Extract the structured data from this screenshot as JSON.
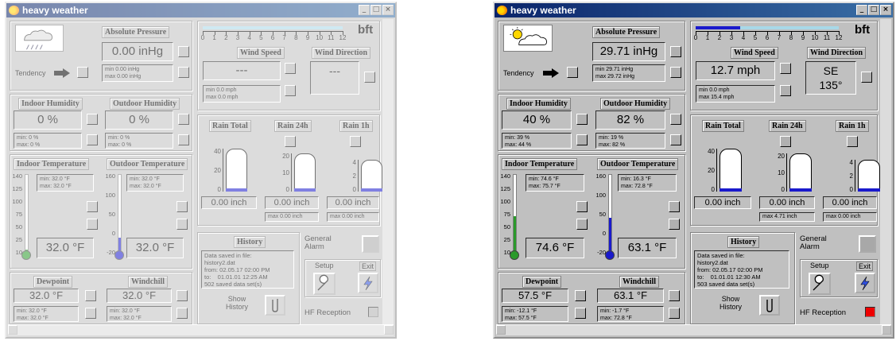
{
  "windows": [
    {
      "title": "heavy weather",
      "state": "faded",
      "pressure": {
        "label": "Absolute Pressure",
        "value": "0.00 inHg",
        "min": "min 0.00 inHg",
        "max": "max 0.00 inHg"
      },
      "tendency": "Tendency",
      "bft": "bft",
      "wind_speed": {
        "label": "Wind Speed",
        "value": "---",
        "min": "min 0.0 mph",
        "max": "max 0.0 mph"
      },
      "wind_dir": {
        "label": "Wind Direction",
        "value": "---"
      },
      "indoor_humidity": {
        "label": "Indoor Humidity",
        "value": "0 %",
        "min": "min: 0 %",
        "max": "max: 0 %"
      },
      "outdoor_humidity": {
        "label": "Outdoor Humidity",
        "value": "0 %",
        "min": "min: 0 %",
        "max": "max: 0 %"
      },
      "rain": {
        "total": "Rain Total",
        "h24": "Rain 24h",
        "h1": "Rain 1h",
        "total_value": "0.00 inch",
        "h24_value": "0.00 inch",
        "h1_value": "0.00 inch",
        "h24_max": "max 0.00 inch",
        "h1_max": "max 0.00 inch"
      },
      "indoor_temp": {
        "label": "Indoor Temperature",
        "value": "32.0 °F",
        "min": "min: 32.0 °F",
        "max": "max: 32.0 °F"
      },
      "outdoor_temp": {
        "label": "Outdoor Temperature",
        "value": "32.0 °F",
        "min": "min: 32.0 °F",
        "max": "max: 32.0 °F"
      },
      "dewpoint": {
        "label": "Dewpoint",
        "value": "32.0 °F",
        "min": "min: 32.0 °F",
        "max": "max: 32.0 °F"
      },
      "windchill": {
        "label": "Windchill",
        "value": "32.0 °F",
        "min": "min: 32.0 °F",
        "max": "max: 32.0 °F"
      },
      "history": {
        "label": "History",
        "line1": "Data saved in file:",
        "line2": "history2.dat",
        "line3": "from: 02.05.17 02:00 PM",
        "line4": "to:    01.01.01 12:25 AM",
        "line5": "502 saved data set(s)",
        "show": "Show History"
      },
      "general_alarm": "General Alarm",
      "setup": "Setup",
      "exit": "Exit",
      "hf": "HF Reception"
    },
    {
      "title": "heavy weather",
      "state": "active",
      "pressure": {
        "label": "Absolute Pressure",
        "value": "29.71 inHg",
        "min": "min 29.71 inHg",
        "max": "max 29.72 inHg"
      },
      "tendency": "Tendency",
      "bft": "bft",
      "wind_speed": {
        "label": "Wind Speed",
        "value": "12.7 mph",
        "min": "min 0.0 mph",
        "max": "max 15.4 mph"
      },
      "wind_dir": {
        "label": "Wind Direction",
        "value": "SE",
        "value2": "135°"
      },
      "indoor_humidity": {
        "label": "Indoor Humidity",
        "value": "40 %",
        "min": "min: 39 %",
        "max": "max: 44 %"
      },
      "outdoor_humidity": {
        "label": "Outdoor Humidity",
        "value": "82 %",
        "min": "min: 19 %",
        "max": "max: 82 %"
      },
      "rain": {
        "total": "Rain Total",
        "h24": "Rain 24h",
        "h1": "Rain 1h",
        "total_value": "0.00 inch",
        "h24_value": "0.00 inch",
        "h1_value": "0.00 inch",
        "h24_max": "max 4.71 inch",
        "h1_max": "max 0.00 inch"
      },
      "indoor_temp": {
        "label": "Indoor Temperature",
        "value": "74.6 °F",
        "min": "min: 74.6 °F",
        "max": "max: 75.7 °F"
      },
      "outdoor_temp": {
        "label": "Outdoor Temperature",
        "value": "63.1 °F",
        "min": "min: 16.3 °F",
        "max": "max: 72.8 °F"
      },
      "dewpoint": {
        "label": "Dewpoint",
        "value": "57.5 °F",
        "min": "min: -12.1 °F",
        "max": "max: 57.5 °F"
      },
      "windchill": {
        "label": "Windchill",
        "value": "63.1 °F",
        "min": "min: -1.7 °F",
        "max": "max: 72.8 °F"
      },
      "history": {
        "label": "History",
        "line1": "Data saved in file:",
        "line2": "history2.dat",
        "line3": "from: 02.05.17 02:00 PM",
        "line4": "to:    01.01.01 12:30 AM",
        "line5": "503 saved data set(s)",
        "show": "Show History"
      },
      "general_alarm": "General Alarm",
      "setup": "Setup",
      "exit": "Exit",
      "hf": "HF Reception"
    }
  ],
  "bft_ticks": [
    "0",
    "1",
    "2",
    "3",
    "4",
    "5",
    "6",
    "7",
    "8",
    "9",
    "10",
    "11",
    "12"
  ],
  "rain_ticks_total": [
    "40",
    "20",
    "0"
  ],
  "rain_ticks_24h": [
    "20",
    "10",
    "0"
  ],
  "rain_ticks_1h": [
    "4",
    "2",
    "0"
  ],
  "indoor_temp_ticks": [
    "140",
    "125",
    "100",
    "75",
    "50",
    "25",
    "10"
  ],
  "outdoor_temp_ticks": [
    "160",
    "100",
    "50",
    "0",
    "-20"
  ],
  "wind_bft_level": 3.7,
  "colors": {
    "titlebar": "#0a246a",
    "accent_blue": "#1a1acc",
    "green": "#2a9a2a",
    "alarm_red": "#ee0000"
  }
}
